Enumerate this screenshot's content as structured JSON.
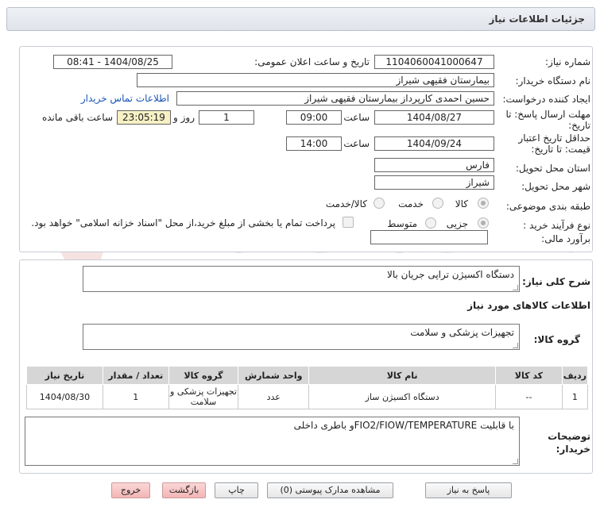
{
  "header": {
    "title": "جزئیات اطلاعات نیاز"
  },
  "form": {
    "need_number": {
      "label": "شماره نیاز:",
      "value": "1104060041000647"
    },
    "announce_date": {
      "label": "تاریخ و ساعت اعلان عمومی:",
      "value": "1404/08/25 - 08:41"
    },
    "buyer_org": {
      "label": "نام دستگاه خریدار:",
      "value": "بیمارستان فقیهی شیراز"
    },
    "requester": {
      "label": "ایجاد کننده درخواست:",
      "value": "حسین احمدی کارپرداز بیمارستان فقیهی شیراز",
      "contact_link": "اطلاعات تماس خریدار"
    },
    "deadline": {
      "label_line1": "مهلت ارسال پاسخ: تا",
      "label_line2": "تاریخ:",
      "date": "1404/08/27",
      "time_label": "ساعت",
      "time": "09:00",
      "days": "1",
      "days_label": "روز و",
      "remaining": "23:05:19",
      "remaining_label": "ساعت باقی مانده"
    },
    "price_validity": {
      "label_line1": "حداقل تاریخ اعتبار",
      "label_line2": "قیمت: تا تاریخ:",
      "date": "1404/09/24",
      "time_label": "ساعت",
      "time": "14:00"
    },
    "province": {
      "label": "استان محل تحویل:",
      "value": "فارس"
    },
    "city": {
      "label": "شهر محل تحویل:",
      "value": "شیراز"
    },
    "category": {
      "label": "طبقه بندی موضوعی:",
      "options": [
        "کالا",
        "خدمت",
        "کالا/خدمت"
      ],
      "selected": "کالا"
    },
    "purchase_type": {
      "label": "نوع فرآیند خرید :",
      "options": [
        "جزیی",
        "متوسط"
      ],
      "selected": "جزیی",
      "payment_note": "پرداخت تمام یا بخشی از مبلغ خرید،از محل \"اسناد خزانه اسلامی\" خواهد بود."
    },
    "estimate": {
      "label": "برآورد مالی:",
      "value": ""
    }
  },
  "description": {
    "label": "شرح کلی نیاز:",
    "value": "دستگاه اکسیژن تراپی جریان بالا"
  },
  "goods_section": {
    "title": "اطلاعات کالاهای مورد نیاز",
    "group_label": "گروه کالا:",
    "group_value": "تجهیزات پزشکی و سلامت"
  },
  "items_table": {
    "headers": [
      "ردیف",
      "کد کالا",
      "نام کالا",
      "واحد شمارش",
      "گروه کالا",
      "تعداد / مقدار",
      "تاریخ نیاز"
    ],
    "rows": [
      [
        "1",
        "--",
        "دستگاه اکسیژن ساز",
        "عدد",
        "تجهیزات پزشکی و سلامت",
        "1",
        "1404/08/30"
      ]
    ]
  },
  "buyer_notes": {
    "label_line1": "توضیحات",
    "label_line2": "خریدار:",
    "value": "با قابلیت FIO2/FIOW/TEMPERATUREو باطری داخلی"
  },
  "buttons": {
    "reply": "پاسخ به نیاز",
    "attachments": "مشاهده مدارک پیوستی (0)",
    "print": "چاپ",
    "back": "بازگشت",
    "exit": "خروج"
  },
  "watermark": {
    "text": "AriaTender.neT"
  }
}
